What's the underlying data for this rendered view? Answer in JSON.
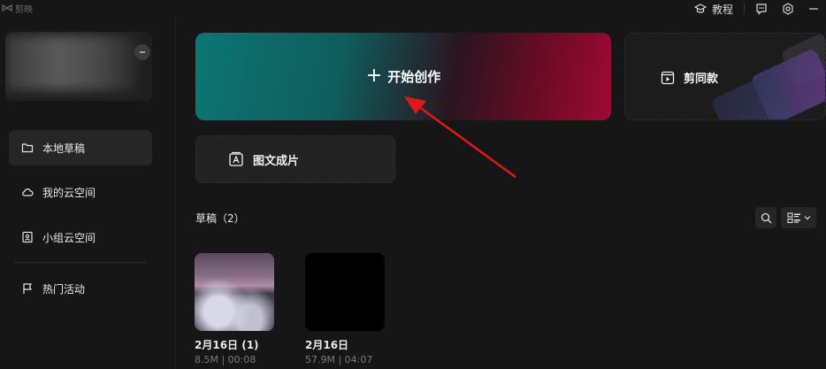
{
  "app": {
    "name": "剪映"
  },
  "titlebar": {
    "tutorial_label": "教程"
  },
  "sidebar": {
    "items": [
      {
        "label": "本地草稿",
        "icon": "folder-icon",
        "active": true
      },
      {
        "label": "我的云空间",
        "icon": "cloud-icon",
        "active": false
      },
      {
        "label": "小组云空间",
        "icon": "group-space-icon",
        "active": false
      },
      {
        "label": "热门活动",
        "icon": "flag-icon",
        "active": false
      }
    ]
  },
  "main": {
    "create_label": "开始创作",
    "template_label": "剪同款",
    "imgtext_label": "图文成片",
    "drafts_title": "草稿（2）",
    "drafts": [
      {
        "name": "2月16日 (1)",
        "meta": "8.5M | 00:08"
      },
      {
        "name": "2月16日",
        "meta": "57.9M | 04:07"
      }
    ]
  },
  "colors": {
    "background": "#161616",
    "create_gradient_start": "#0c7673",
    "create_gradient_end": "#9e0a35",
    "annotation_arrow": "#e01818"
  }
}
